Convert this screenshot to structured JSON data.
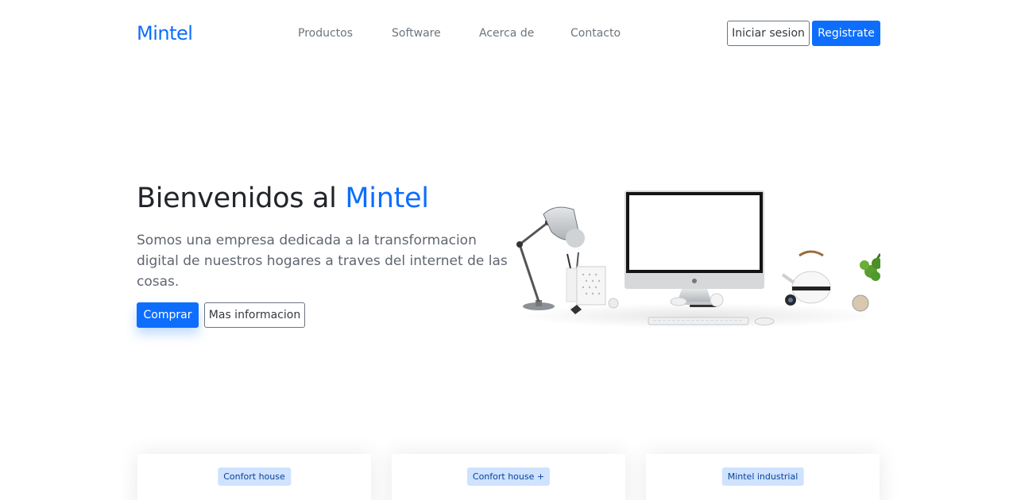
{
  "nav": {
    "brand": "Mintel",
    "links": [
      "Productos",
      "Software",
      "Acerca de",
      "Contacto"
    ],
    "login_label": "Iniciar sesion",
    "register_label": "Registrate"
  },
  "hero": {
    "title_prefix": "Bienvenidos al ",
    "title_accent": "Mintel",
    "subtitle": "Somos una empresa dedicada a la transformacion digital de nuestros hogares a traves del internet de las cosas.",
    "primary_button": "Comprar",
    "secondary_button": "Mas informacion"
  },
  "cards": [
    {
      "badge": "Confort house"
    },
    {
      "badge": "Confort house +"
    },
    {
      "badge": "Mintel industrial"
    }
  ],
  "colors": {
    "primary": "#0d6efd",
    "muted": "#6c757d",
    "badge_bg": "#cfe2ff"
  }
}
